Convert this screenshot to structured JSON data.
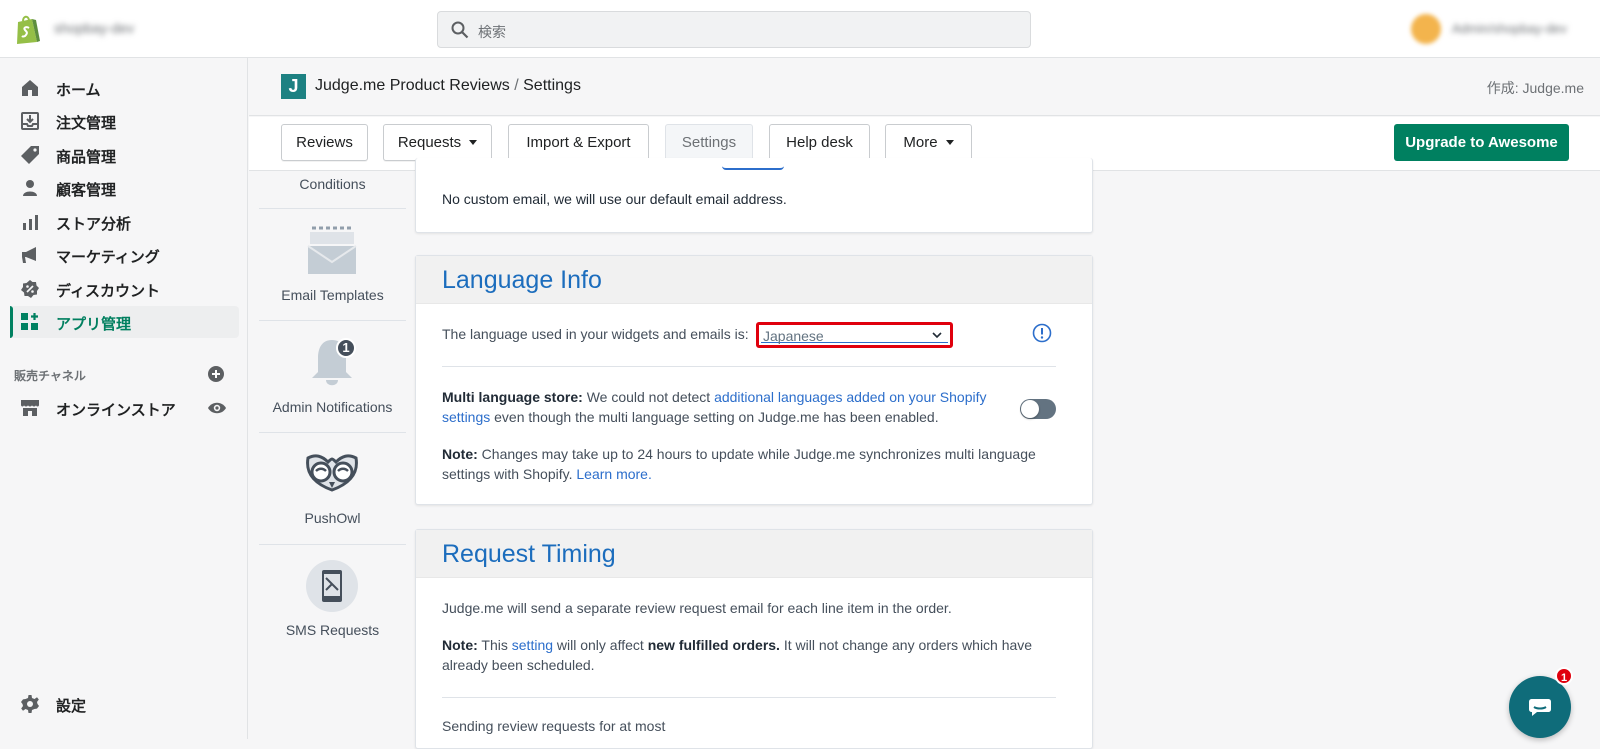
{
  "topbar": {
    "store_name": "shopbay-dev",
    "search_placeholder": "検索",
    "user_name": "Admin/shopbay-dev"
  },
  "sidebar": {
    "items": [
      {
        "label": "ホーム",
        "icon": "home-icon"
      },
      {
        "label": "注文管理",
        "icon": "orders-icon"
      },
      {
        "label": "商品管理",
        "icon": "tag-icon"
      },
      {
        "label": "顧客管理",
        "icon": "person-icon"
      },
      {
        "label": "ストア分析",
        "icon": "bar-chart-icon"
      },
      {
        "label": "マーケティング",
        "icon": "megaphone-icon"
      },
      {
        "label": "ディスカウント",
        "icon": "discount-icon"
      },
      {
        "label": "アプリ管理",
        "icon": "apps-icon"
      }
    ],
    "sales_channels_label": "販売チャネル",
    "online_store_label": "オンラインストア",
    "settings_label": "設定"
  },
  "app_header": {
    "logo_letter": "J",
    "app_name": "Judge.me Product Reviews",
    "separator": "/",
    "page": "Settings",
    "by": "作成: Judge.me"
  },
  "tabs": {
    "reviews": "Reviews",
    "requests": "Requests",
    "import_export": "Import & Export",
    "settings": "Settings",
    "help_desk": "Help desk",
    "more": "More",
    "upgrade": "Upgrade to Awesome"
  },
  "settings_nav": {
    "conditions": "Conditions",
    "email_templates": "Email Templates",
    "admin_notifications": "Admin Notifications",
    "admin_notifications_badge": "1",
    "pushowl": "PushOwl",
    "sms_requests": "SMS Requests"
  },
  "email_card": {
    "text": "No custom email, we will use our default email address."
  },
  "language_card": {
    "title": "Language Info",
    "lang_label": "The language used in your widgets and emails is:",
    "lang_value": "Japanese",
    "multi_bold": "Multi language store:",
    "multi_text1": "We could not detect",
    "multi_link": "additional languages added on your Shopify settings",
    "multi_text2": "even though the multi language setting on Judge.me has been enabled.",
    "note_bold": "Note:",
    "note_text": "Changes may take up to 24 hours to update while Judge.me synchronizes multi language settings with Shopify.",
    "note_link": "Learn more.",
    "multi_toggle_on": false
  },
  "timing_card": {
    "title": "Request Timing",
    "line1": "Judge.me will send a separate review request email for each line item in the order.",
    "note_bold": "Note:",
    "note_text1": "This",
    "note_link": "setting",
    "note_text2": "will only affect",
    "note_bold2": "new fulfilled orders.",
    "note_text3": "It will not change any orders which have already been scheduled.",
    "cut_text": "Sending review requests for at most"
  },
  "chat": {
    "badge": "1"
  },
  "colors": {
    "accent_green": "#008060",
    "link_blue": "#2c6ecb",
    "heading_blue": "#1c6dbd",
    "highlight_red": "#e0000d",
    "app_logo_teal": "#1d8182"
  }
}
